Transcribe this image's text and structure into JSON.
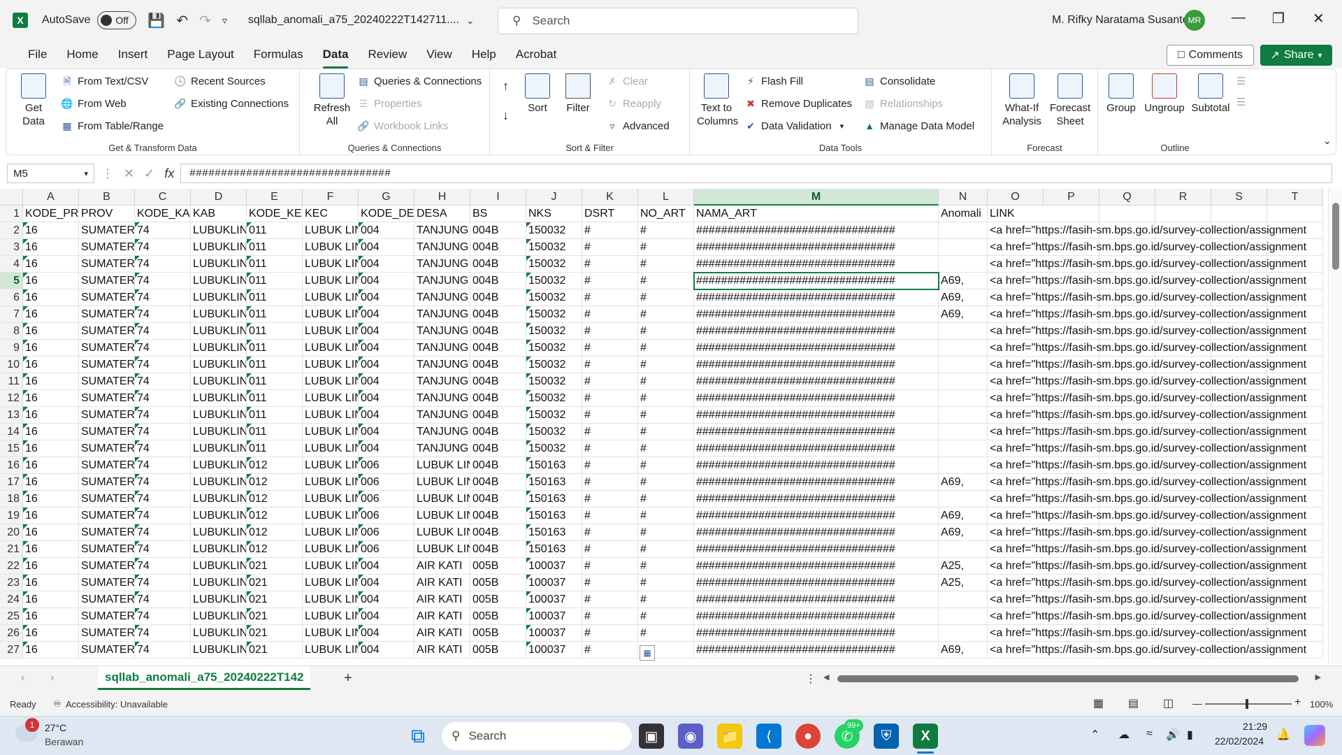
{
  "title_bar": {
    "autosave_label": "AutoSave",
    "autosave_state": "Off",
    "filename": "sqllab_anomali_a75_20240222T142711....",
    "search_placeholder": "Search",
    "user_name": "M. Rifky Naratama Susanto",
    "user_initials": "MR"
  },
  "menu": [
    "File",
    "Home",
    "Insert",
    "Page Layout",
    "Formulas",
    "Data",
    "Review",
    "View",
    "Help",
    "Acrobat"
  ],
  "active_menu": "Data",
  "comments_label": "Comments",
  "share_label": "Share",
  "ribbon": {
    "get_data": {
      "label": "Get Data",
      "line1": "Get",
      "line2": "Data"
    },
    "get_transform": [
      "From Text/CSV",
      "From Web",
      "From Table/Range",
      "Recent Sources",
      "Existing Connections"
    ],
    "get_transform_label": "Get & Transform Data",
    "refresh": {
      "line1": "Refresh",
      "line2": "All"
    },
    "queries": [
      "Queries & Connections",
      "Properties",
      "Workbook Links"
    ],
    "queries_label": "Queries & Connections",
    "sort_label": "Sort",
    "filter_label": "Filter",
    "filter_items": [
      "Clear",
      "Reapply",
      "Advanced"
    ],
    "sort_filter_label": "Sort & Filter",
    "text_to_columns": {
      "line1": "Text to",
      "line2": "Columns"
    },
    "data_tools": [
      "Flash Fill",
      "Remove Duplicates",
      "Data Validation",
      "Consolidate",
      "Relationships",
      "Manage Data Model"
    ],
    "data_tools_label": "Data Tools",
    "what_if": {
      "line1": "What-If",
      "line2": "Analysis"
    },
    "forecast_sheet": {
      "line1": "Forecast",
      "line2": "Sheet"
    },
    "forecast_label": "Forecast",
    "outline": [
      "Group",
      "Ungroup",
      "Subtotal"
    ],
    "outline_label": "Outline"
  },
  "formula_bar": {
    "name_box": "M5",
    "formula": "################################"
  },
  "columns": [
    "A",
    "B",
    "C",
    "D",
    "E",
    "F",
    "G",
    "H",
    "I",
    "J",
    "K",
    "L",
    "M",
    "N",
    "O",
    "P",
    "Q",
    "R",
    "S",
    "T"
  ],
  "selected_column": "M",
  "selected_row": 5,
  "header_row": [
    "KODE_PRO",
    "PROV",
    "KODE_KAB",
    "KAB",
    "KODE_KEC",
    "KEC",
    "KODE_DES",
    "DESA",
    "BS",
    "NKS",
    "DSRT",
    "NO_ART",
    "NAMA_ART",
    "Anomali",
    "LINK",
    "",
    "",
    "",
    "",
    ""
  ],
  "rows": [
    [
      "16",
      "SUMATERA",
      "74",
      "LUBUKLIN",
      "011",
      "LUBUK LIN",
      "004",
      "TANJUNG",
      "004B",
      "150032",
      "#",
      "#",
      "################################",
      "",
      "<a href=\"https://fasih-sm.bps.go.id/survey-collection/assignment"
    ],
    [
      "16",
      "SUMATERA",
      "74",
      "LUBUKLIN",
      "011",
      "LUBUK LIN",
      "004",
      "TANJUNG",
      "004B",
      "150032",
      "#",
      "#",
      "################################",
      "",
      "<a href=\"https://fasih-sm.bps.go.id/survey-collection/assignment"
    ],
    [
      "16",
      "SUMATERA",
      "74",
      "LUBUKLIN",
      "011",
      "LUBUK LIN",
      "004",
      "TANJUNG",
      "004B",
      "150032",
      "#",
      "#",
      "################################",
      "",
      "<a href=\"https://fasih-sm.bps.go.id/survey-collection/assignment"
    ],
    [
      "16",
      "SUMATERA",
      "74",
      "LUBUKLIN",
      "011",
      "LUBUK LIN",
      "004",
      "TANJUNG",
      "004B",
      "150032",
      "#",
      "#",
      "################################",
      "A69,",
      "<a href=\"https://fasih-sm.bps.go.id/survey-collection/assignment"
    ],
    [
      "16",
      "SUMATERA",
      "74",
      "LUBUKLIN",
      "011",
      "LUBUK LIN",
      "004",
      "TANJUNG",
      "004B",
      "150032",
      "#",
      "#",
      "################################",
      "A69,",
      "<a href=\"https://fasih-sm.bps.go.id/survey-collection/assignment"
    ],
    [
      "16",
      "SUMATERA",
      "74",
      "LUBUKLIN",
      "011",
      "LUBUK LIN",
      "004",
      "TANJUNG",
      "004B",
      "150032",
      "#",
      "#",
      "################################",
      "A69,",
      "<a href=\"https://fasih-sm.bps.go.id/survey-collection/assignment"
    ],
    [
      "16",
      "SUMATERA",
      "74",
      "LUBUKLIN",
      "011",
      "LUBUK LIN",
      "004",
      "TANJUNG",
      "004B",
      "150032",
      "#",
      "#",
      "################################",
      "",
      "<a href=\"https://fasih-sm.bps.go.id/survey-collection/assignment"
    ],
    [
      "16",
      "SUMATERA",
      "74",
      "LUBUKLIN",
      "011",
      "LUBUK LIN",
      "004",
      "TANJUNG",
      "004B",
      "150032",
      "#",
      "#",
      "################################",
      "",
      "<a href=\"https://fasih-sm.bps.go.id/survey-collection/assignment"
    ],
    [
      "16",
      "SUMATERA",
      "74",
      "LUBUKLIN",
      "011",
      "LUBUK LIN",
      "004",
      "TANJUNG",
      "004B",
      "150032",
      "#",
      "#",
      "################################",
      "",
      "<a href=\"https://fasih-sm.bps.go.id/survey-collection/assignment"
    ],
    [
      "16",
      "SUMATERA",
      "74",
      "LUBUKLIN",
      "011",
      "LUBUK LIN",
      "004",
      "TANJUNG",
      "004B",
      "150032",
      "#",
      "#",
      "################################",
      "",
      "<a href=\"https://fasih-sm.bps.go.id/survey-collection/assignment"
    ],
    [
      "16",
      "SUMATERA",
      "74",
      "LUBUKLIN",
      "011",
      "LUBUK LIN",
      "004",
      "TANJUNG",
      "004B",
      "150032",
      "#",
      "#",
      "################################",
      "",
      "<a href=\"https://fasih-sm.bps.go.id/survey-collection/assignment"
    ],
    [
      "16",
      "SUMATERA",
      "74",
      "LUBUKLIN",
      "011",
      "LUBUK LIN",
      "004",
      "TANJUNG",
      "004B",
      "150032",
      "#",
      "#",
      "################################",
      "",
      "<a href=\"https://fasih-sm.bps.go.id/survey-collection/assignment"
    ],
    [
      "16",
      "SUMATERA",
      "74",
      "LUBUKLIN",
      "011",
      "LUBUK LIN",
      "004",
      "TANJUNG",
      "004B",
      "150032",
      "#",
      "#",
      "################################",
      "",
      "<a href=\"https://fasih-sm.bps.go.id/survey-collection/assignment"
    ],
    [
      "16",
      "SUMATERA",
      "74",
      "LUBUKLIN",
      "011",
      "LUBUK LIN",
      "004",
      "TANJUNG",
      "004B",
      "150032",
      "#",
      "#",
      "################################",
      "",
      "<a href=\"https://fasih-sm.bps.go.id/survey-collection/assignment"
    ],
    [
      "16",
      "SUMATERA",
      "74",
      "LUBUKLIN",
      "012",
      "LUBUK LIN",
      "006",
      "LUBUK LIN",
      "004B",
      "150163",
      "#",
      "#",
      "################################",
      "",
      "<a href=\"https://fasih-sm.bps.go.id/survey-collection/assignment"
    ],
    [
      "16",
      "SUMATERA",
      "74",
      "LUBUKLIN",
      "012",
      "LUBUK LIN",
      "006",
      "LUBUK LIN",
      "004B",
      "150163",
      "#",
      "#",
      "################################",
      "A69,",
      "<a href=\"https://fasih-sm.bps.go.id/survey-collection/assignment"
    ],
    [
      "16",
      "SUMATERA",
      "74",
      "LUBUKLIN",
      "012",
      "LUBUK LIN",
      "006",
      "LUBUK LIN",
      "004B",
      "150163",
      "#",
      "#",
      "################################",
      "",
      "<a href=\"https://fasih-sm.bps.go.id/survey-collection/assignment"
    ],
    [
      "16",
      "SUMATERA",
      "74",
      "LUBUKLIN",
      "012",
      "LUBUK LIN",
      "006",
      "LUBUK LIN",
      "004B",
      "150163",
      "#",
      "#",
      "################################",
      "A69,",
      "<a href=\"https://fasih-sm.bps.go.id/survey-collection/assignment"
    ],
    [
      "16",
      "SUMATERA",
      "74",
      "LUBUKLIN",
      "012",
      "LUBUK LIN",
      "006",
      "LUBUK LIN",
      "004B",
      "150163",
      "#",
      "#",
      "################################",
      "A69,",
      "<a href=\"https://fasih-sm.bps.go.id/survey-collection/assignment"
    ],
    [
      "16",
      "SUMATERA",
      "74",
      "LUBUKLIN",
      "012",
      "LUBUK LIN",
      "006",
      "LUBUK LIN",
      "004B",
      "150163",
      "#",
      "#",
      "################################",
      "",
      "<a href=\"https://fasih-sm.bps.go.id/survey-collection/assignment"
    ],
    [
      "16",
      "SUMATERA",
      "74",
      "LUBUKLIN",
      "021",
      "LUBUK LIN",
      "004",
      "AIR KATI",
      "005B",
      "100037",
      "#",
      "#",
      "################################",
      "A25,",
      "<a href=\"https://fasih-sm.bps.go.id/survey-collection/assignment"
    ],
    [
      "16",
      "SUMATERA",
      "74",
      "LUBUKLIN",
      "021",
      "LUBUK LIN",
      "004",
      "AIR KATI",
      "005B",
      "100037",
      "#",
      "#",
      "################################",
      "A25,",
      "<a href=\"https://fasih-sm.bps.go.id/survey-collection/assignment"
    ],
    [
      "16",
      "SUMATERA",
      "74",
      "LUBUKLIN",
      "021",
      "LUBUK LIN",
      "004",
      "AIR KATI",
      "005B",
      "100037",
      "#",
      "#",
      "################################",
      "",
      "<a href=\"https://fasih-sm.bps.go.id/survey-collection/assignment"
    ],
    [
      "16",
      "SUMATERA",
      "74",
      "LUBUKLIN",
      "021",
      "LUBUK LIN",
      "004",
      "AIR KATI",
      "005B",
      "100037",
      "#",
      "#",
      "################################",
      "",
      "<a href=\"https://fasih-sm.bps.go.id/survey-collection/assignment"
    ],
    [
      "16",
      "SUMATERA",
      "74",
      "LUBUKLIN",
      "021",
      "LUBUK LIN",
      "004",
      "AIR KATI",
      "005B",
      "100037",
      "#",
      "#",
      "################################",
      "",
      "<a href=\"https://fasih-sm.bps.go.id/survey-collection/assignment"
    ],
    [
      "16",
      "SUMATERA",
      "74",
      "LUBUKLIN",
      "021",
      "LUBUK LIN",
      "004",
      "AIR KATI",
      "005B",
      "100037",
      "#",
      "",
      "################################",
      "A69,",
      "<a href=\"https://fasih-sm.bps.go.id/survey-collection/assignment"
    ]
  ],
  "sheet_tab": "sqllab_anomali_a75_20240222T142",
  "status": {
    "ready": "Ready",
    "accessibility": "Accessibility: Unavailable",
    "zoom": "100%"
  },
  "taskbar": {
    "weather_temp": "27°C",
    "weather_desc": "Berawan",
    "weather_badge": "1",
    "search_label": "Search",
    "whatsapp_badge": "99+",
    "time": "21:29",
    "date": "22/02/2024"
  }
}
